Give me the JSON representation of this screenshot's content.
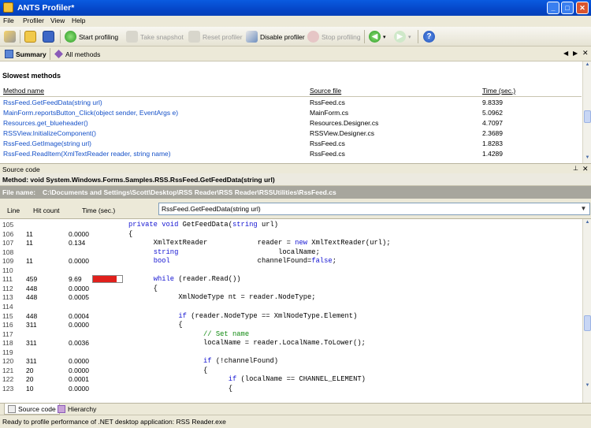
{
  "window": {
    "title": "ANTS Profiler*"
  },
  "menu": [
    "File",
    "Profiler",
    "View",
    "Help"
  ],
  "toolbar": {
    "start": "Start profiling",
    "snapshot": "Take snapshot",
    "reset": "Reset profiler",
    "disable": "Disable profiler",
    "stop": "Stop profiling"
  },
  "view_tabs": {
    "summary": "Summary",
    "all_methods": "All methods"
  },
  "summary": {
    "title": "Slowest methods",
    "columns": [
      "Method name",
      "Source file",
      "Time (sec.)"
    ],
    "rows": [
      [
        "RssFeed.GetFeedData(string url)",
        "RssFeed.cs",
        "9.8339"
      ],
      [
        "MainForm.reportsButton_Click(object sender, EventArgs e)",
        "MainForm.cs",
        "5.0962"
      ],
      [
        "Resources.get_blueheader()",
        "Resources.Designer.cs",
        "4.7097"
      ],
      [
        "RSSView.InitializeComponent()",
        "RSSView.Designer.cs",
        "2.3689"
      ],
      [
        "RssFeed.GetImage(string url)",
        "RssFeed.cs",
        "1.8283"
      ],
      [
        "RssFeed.ReadItem(XmlTextReader reader, string name)",
        "RssFeed.cs",
        "1.4289"
      ]
    ]
  },
  "source": {
    "panel_title": "Source code",
    "method_label": "Method: void System.Windows.Forms.Samples.RSS.RssFeed.GetFeedData(string url)",
    "file_label": "File name:",
    "file_path": "C:\\Documents and Settings\\Scott\\Desktop\\RSS Reader\\RSS Reader\\RSSUtilities\\RssFeed.cs",
    "columns": {
      "line": "Line",
      "hits": "Hit count",
      "time": "Time (sec.)"
    },
    "method_select": "RssFeed.GetFeedData(string url)",
    "lines": [
      {
        "n": "105",
        "hits": "",
        "time": "",
        "code": [
          [
            "kw",
            "private"
          ],
          [
            "t",
            " "
          ],
          [
            "kw",
            "void"
          ],
          [
            "t",
            " GetFeedData("
          ],
          [
            "kw",
            "string"
          ],
          [
            "t",
            " url)"
          ]
        ]
      },
      {
        "n": "106",
        "hits": "11",
        "time": "0.0000",
        "code": [
          [
            "t",
            "{"
          ]
        ]
      },
      {
        "n": "107",
        "hits": "11",
        "time": "0.134",
        "code": [
          [
            "t",
            "      XmlTextReader            reader = "
          ],
          [
            "kw",
            "new"
          ],
          [
            "t",
            " XmlTextReader(url);"
          ]
        ]
      },
      {
        "n": "108",
        "hits": "",
        "time": "",
        "code": [
          [
            "t",
            "      "
          ],
          [
            "kw",
            "string"
          ],
          [
            "t",
            "                        localName;"
          ]
        ]
      },
      {
        "n": "109",
        "hits": "11",
        "time": "0.0000",
        "code": [
          [
            "t",
            "      "
          ],
          [
            "kw",
            "bool"
          ],
          [
            "t",
            "                     channelFound="
          ],
          [
            "kw",
            "false"
          ],
          [
            "t",
            ";"
          ]
        ]
      },
      {
        "n": "110",
        "hits": "",
        "time": "",
        "code": []
      },
      {
        "n": "111",
        "hits": "459",
        "time": "9.69",
        "bar": 0.82,
        "code": [
          [
            "t",
            "      "
          ],
          [
            "kw",
            "while"
          ],
          [
            "t",
            " (reader.Read())"
          ]
        ]
      },
      {
        "n": "112",
        "hits": "448",
        "time": "0.0000",
        "code": [
          [
            "t",
            "      {"
          ]
        ]
      },
      {
        "n": "113",
        "hits": "448",
        "time": "0.0005",
        "code": [
          [
            "t",
            "            XmlNodeType nt = reader.NodeType;"
          ]
        ]
      },
      {
        "n": "114",
        "hits": "",
        "time": "",
        "code": []
      },
      {
        "n": "115",
        "hits": "448",
        "time": "0.0004",
        "code": [
          [
            "t",
            "            "
          ],
          [
            "kw",
            "if"
          ],
          [
            "t",
            " (reader.NodeType == XmlNodeType.Element)"
          ]
        ]
      },
      {
        "n": "116",
        "hits": "311",
        "time": "0.0000",
        "code": [
          [
            "t",
            "            {"
          ]
        ]
      },
      {
        "n": "117",
        "hits": "",
        "time": "",
        "code": [
          [
            "t",
            "                  "
          ],
          [
            "cm",
            "// Set name"
          ]
        ]
      },
      {
        "n": "118",
        "hits": "311",
        "time": "0.0036",
        "code": [
          [
            "t",
            "                  localName = reader.LocalName.ToLower();"
          ]
        ]
      },
      {
        "n": "119",
        "hits": "",
        "time": "",
        "code": []
      },
      {
        "n": "120",
        "hits": "311",
        "time": "0.0000",
        "code": [
          [
            "t",
            "                  "
          ],
          [
            "kw",
            "if"
          ],
          [
            "t",
            " (!channelFound)"
          ]
        ]
      },
      {
        "n": "121",
        "hits": "20",
        "time": "0.0000",
        "code": [
          [
            "t",
            "                  {"
          ]
        ]
      },
      {
        "n": "122",
        "hits": "20",
        "time": "0.0001",
        "code": [
          [
            "t",
            "                        "
          ],
          [
            "kw",
            "if"
          ],
          [
            "t",
            " (localName == CHANNEL_ELEMENT)"
          ]
        ]
      },
      {
        "n": "123",
        "hits": "10",
        "time": "0.0000",
        "code": [
          [
            "t",
            "                        {"
          ]
        ]
      }
    ]
  },
  "bottom_tabs": {
    "source": "Source code",
    "hierarchy": "Hierarchy"
  },
  "status": "Ready to profile performance of .NET desktop application: RSS Reader.exe",
  "colors": {
    "title_bar": "#0546c8",
    "link": "#1450c8",
    "keyword": "#1414d2",
    "comment": "#118a11",
    "hot_bar": "#e0201c"
  }
}
